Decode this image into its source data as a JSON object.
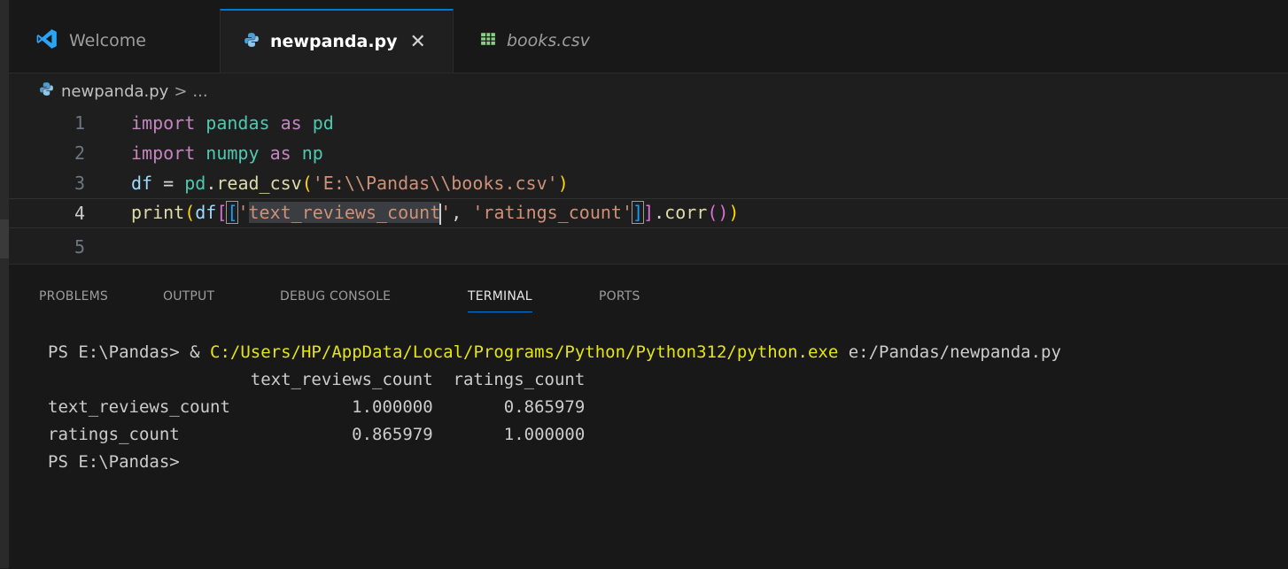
{
  "tabs": [
    {
      "label": "Welcome",
      "icon": "vscode-logo-icon"
    },
    {
      "label": "newpanda.py",
      "icon": "python-icon",
      "close": "✕"
    },
    {
      "label": "books.csv",
      "icon": "table-icon"
    }
  ],
  "breadcrumb": {
    "file": "newpanda.py",
    "separator": ">",
    "more": "..."
  },
  "editor": {
    "line_numbers": [
      "1",
      "2",
      "3",
      "4",
      "5"
    ],
    "line1": {
      "kw1": "import",
      "mod": "pandas",
      "kw2": "as",
      "alias": "pd"
    },
    "line2": {
      "kw1": "import",
      "mod": "numpy",
      "kw2": "as",
      "alias": "np"
    },
    "line3": {
      "var": "df",
      "eq": " = ",
      "obj": "pd",
      "dot": ".",
      "func": "read_csv",
      "open": "(",
      "str": "'E:\\\\Pandas\\\\books.csv'",
      "close": ")"
    },
    "line4": {
      "func": "print",
      "p_open": "(",
      "var": "df",
      "b_open": "[",
      "b_inner_open": "[",
      "q1": "'",
      "sel_text": "text_reviews_count",
      "q2": "'",
      "comma": ", ",
      "str2": "'ratings_count'",
      "b_inner_close": "]",
      "b_close": "]",
      "dot": ".",
      "corr": "corr",
      "c_open": "(",
      "c_close": ")",
      "p_close": ")"
    }
  },
  "panel": {
    "tabs": [
      "PROBLEMS",
      "OUTPUT",
      "DEBUG CONSOLE",
      "TERMINAL",
      "PORTS"
    ],
    "active_tab": "TERMINAL"
  },
  "terminal": {
    "prompt": "PS E:\\Pandas> ",
    "amp": "& ",
    "exe": "C:/Users/HP/AppData/Local/Programs/Python/Python312/python.exe",
    "script": " e:/Pandas/newpanda.py",
    "output_lines": [
      "                    text_reviews_count  ratings_count",
      "text_reviews_count            1.000000       0.865979",
      "ratings_count                 0.865979       1.000000"
    ],
    "final_prompt": "PS E:\\Pandas>"
  },
  "colors": {
    "accent": "#0078d4",
    "background": "#1e1e1e",
    "terminal_exe": "#e5e510"
  }
}
